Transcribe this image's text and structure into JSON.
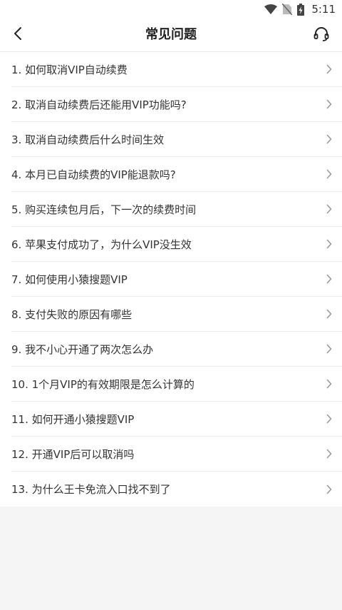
{
  "status_bar": {
    "time": "5:11",
    "icons": [
      "wifi-icon",
      "no-sim-icon",
      "battery-charging-icon"
    ]
  },
  "header": {
    "title": "常见问题",
    "back_icon": "chevron-left-icon",
    "support_icon": "headset-icon"
  },
  "faq": {
    "items": [
      {
        "label": "1. 如何取消VIP自动续费"
      },
      {
        "label": "2. 取消自动续费后还能用VIP功能吗?"
      },
      {
        "label": "3. 取消自动续费后什么时间生效"
      },
      {
        "label": "4. 本月已自动续费的VIP能退款吗?"
      },
      {
        "label": "5. 购买连续包月后，下一次的续费时间"
      },
      {
        "label": "6. 苹果支付成功了，为什么VIP没生效"
      },
      {
        "label": "7. 如何使用小猿搜题VIP"
      },
      {
        "label": "8. 支付失败的原因有哪些"
      },
      {
        "label": "9. 我不小心开通了两次怎么办"
      },
      {
        "label": "10. 1个月VIP的有效期限是怎么计算的"
      },
      {
        "label": "11. 如何开通小猿搜题VIP"
      },
      {
        "label": "12. 开通VIP后可以取消吗"
      },
      {
        "label": "13. 为什么王卡免流入口找不到了"
      }
    ]
  }
}
